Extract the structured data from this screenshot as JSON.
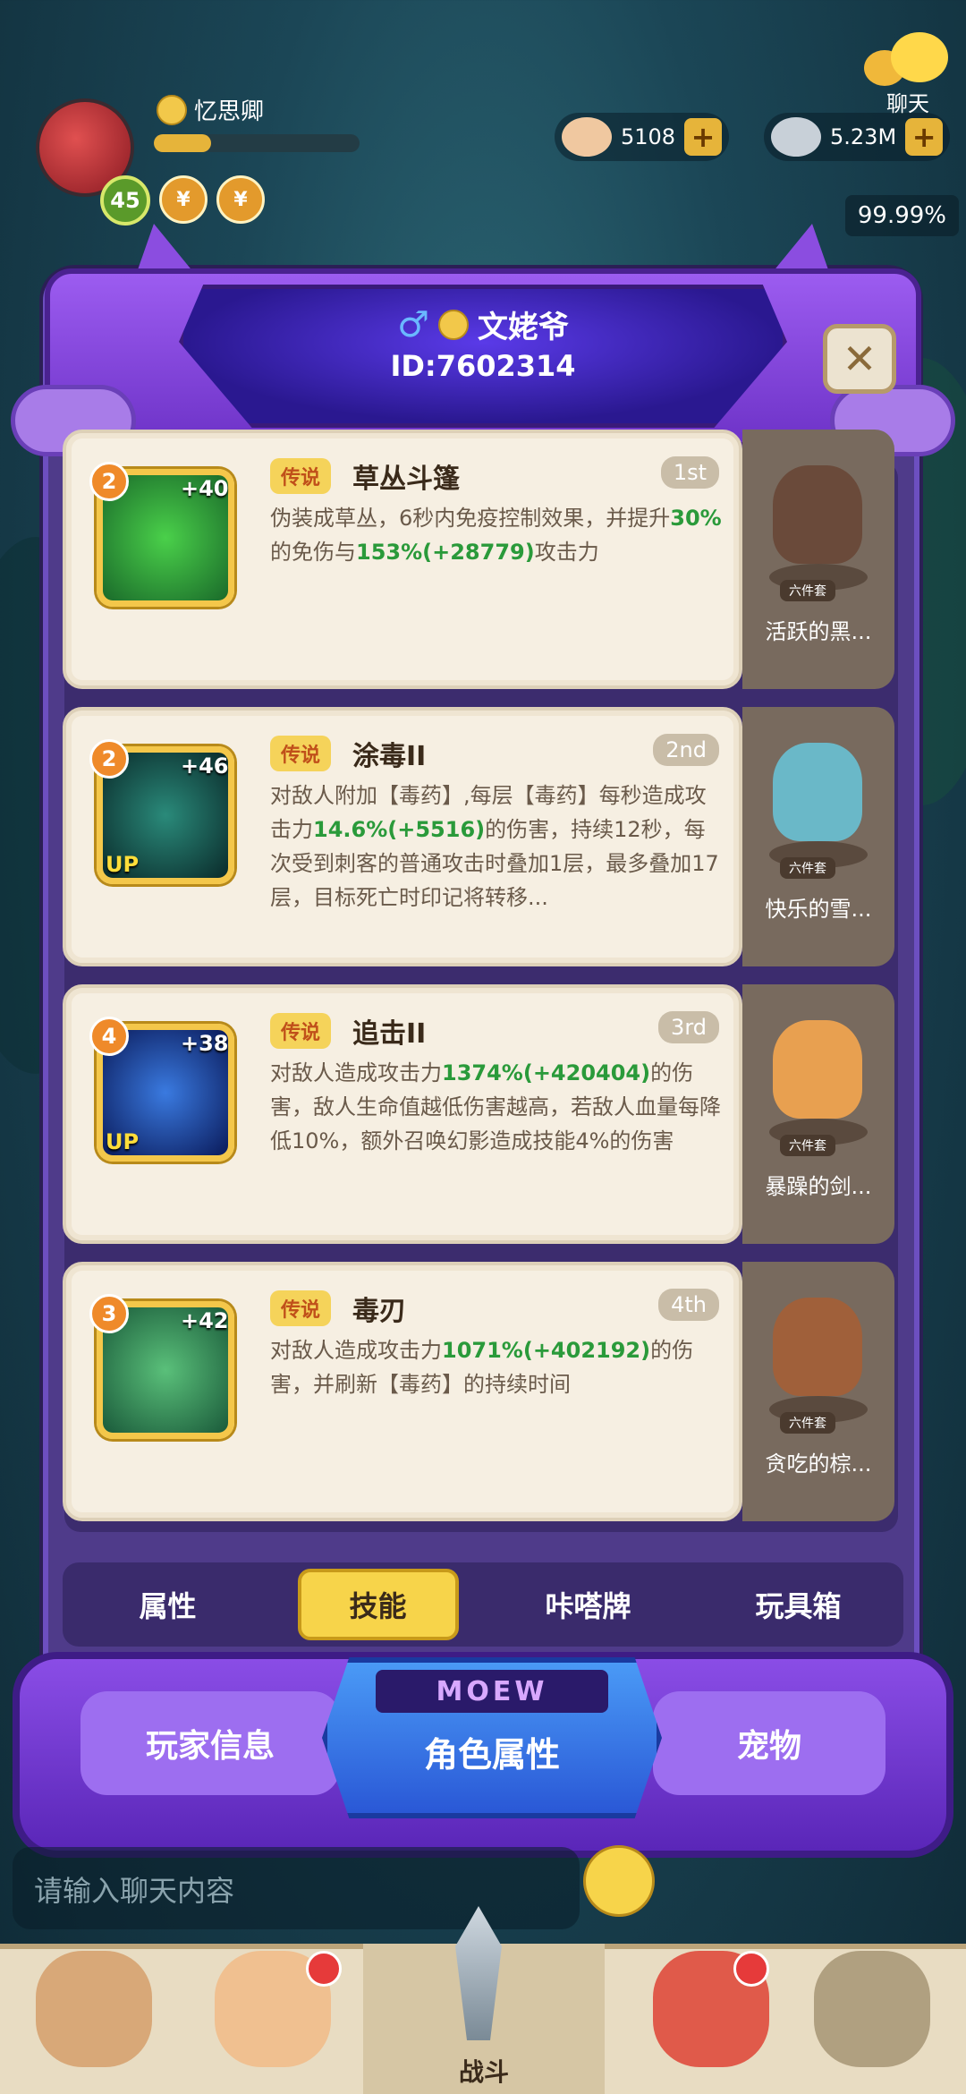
{
  "hud": {
    "player_name": "忆思卿",
    "level": "45",
    "exp_fraction": 0.28,
    "resource_1": "5108",
    "resource_2": "5.23M",
    "percent": "99.99%",
    "chat_label": "聊天",
    "badge_1": "¥",
    "badge_2": "¥"
  },
  "profile": {
    "gender_symbol": "♂",
    "name": "文姥爷",
    "id": "ID:7602314",
    "close_symbol": "✕"
  },
  "skills": [
    {
      "level": "2",
      "plus": "+40",
      "up": "",
      "tag": "传说",
      "title": "草丛斗篷",
      "rank": "1st",
      "desc_parts": [
        "伪装成草丛，6秒内免疫控制效果，并提升",
        "30%",
        "的免伤与",
        "153%",
        "(+28779)",
        "攻击力"
      ],
      "pet_name": "活跃的黑...",
      "pet_tag": "六件套",
      "icon_color": "#2e9a3a"
    },
    {
      "level": "2",
      "plus": "+46",
      "up": "UP",
      "tag": "传说",
      "title": "涂毒II",
      "rank": "2nd",
      "desc_parts": [
        "对敌人附加【毒药】,每层【毒药】每秒造成攻击力",
        "14.6%",
        "(+5516)",
        "的伤害，持续12秒，每次受到刺客的普通攻击时叠加1层，最多叠加17层，目标死亡时印记将转移..."
      ],
      "pet_name": "快乐的雪...",
      "pet_tag": "六件套",
      "icon_color": "#1a4a4a"
    },
    {
      "level": "4",
      "plus": "+38",
      "up": "UP",
      "tag": "传说",
      "title": "追击II",
      "rank": "3rd",
      "desc_parts": [
        "对敌人造成攻击力",
        "1374%",
        "(+420404)",
        "的伤害，敌人生命值越低伤害越高，若敌人血量每降低10%，额外召唤幻影造成技能4%的伤害"
      ],
      "pet_name": "暴躁的剑...",
      "pet_tag": "六件套",
      "icon_color": "#1a3a8a"
    },
    {
      "level": "3",
      "plus": "+42",
      "up": "",
      "tag": "传说",
      "title": "毒刃",
      "rank": "4th",
      "desc_parts": [
        "对敌人造成攻击力",
        "1071%",
        "(+402192)",
        "的伤害，并刷新【毒药】的持续时间"
      ],
      "pet_name": "贪吃的棕...",
      "pet_tag": "六件套",
      "icon_color": "#2a7a4a"
    }
  ],
  "tabs": [
    "属性",
    "技能",
    "咔嗒牌",
    "玩具箱"
  ],
  "active_tab": 1,
  "banner": {
    "left": "玩家信息",
    "center": "角色属性",
    "center_badge": "MOEW",
    "right": "宠物"
  },
  "chat_input": {
    "placeholder": "请输入聊天内容"
  },
  "bottom": {
    "battle_label": "战斗"
  },
  "colors": {
    "panel": "#4f3b8a",
    "card": "#f6efe2",
    "highlight_green": "#2a9a3a",
    "tab_active": "#f7d44a"
  }
}
